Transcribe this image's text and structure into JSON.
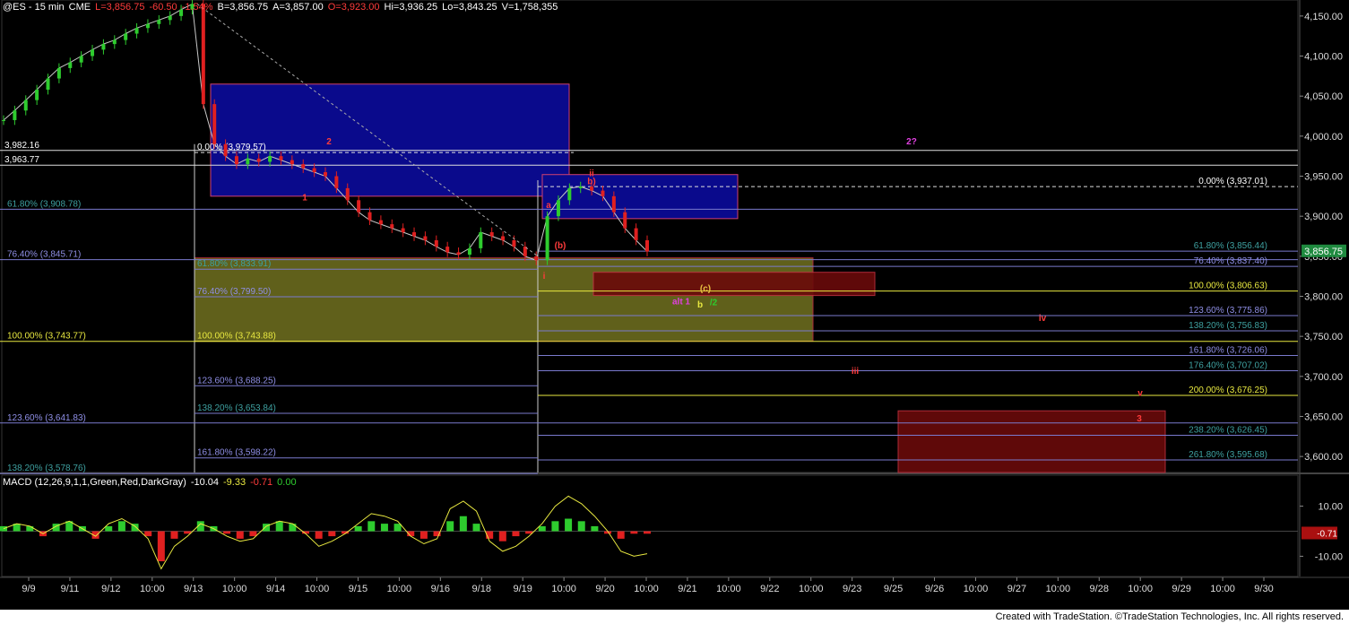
{
  "header": {
    "symbol": "@ES - 15 min",
    "exchange": "CME",
    "last": "L=3,856.75",
    "change": "-60.50",
    "pct": "-1.54%",
    "bid": "B=3,856.75",
    "ask": "A=3,857.00",
    "open": "O=3,923.00",
    "hi": "Hi=3,936.25",
    "lo": "Lo=3,843.25",
    "vol": "V=1,758,355"
  },
  "macd_header": {
    "label": "MACD (12,26,9,1,1,Green,Red,DarkGray)",
    "v1": "-10.04",
    "v2": "-9.33",
    "v3": "-0.71",
    "v4": "0.00"
  },
  "footer": "Created with TradeStation. ©TradeStation Technologies, Inc. All rights reserved.",
  "colors": {
    "background": "#000000",
    "up_candle": "#2ecc2e",
    "down_candle": "#e02020",
    "blue_box": "#0a0a8c",
    "yellow_box": "#6b6b1e",
    "red_box": "#6a0a0a",
    "fib_line": "#7a7acd",
    "price_tag": "#1f8a3f"
  },
  "chart_data": [
    {
      "type": "line",
      "title": "@ES - 15 min",
      "y_ticks": [
        "4,150.00",
        "4,100.00",
        "4,050.00",
        "4,000.00",
        "3,950.00",
        "3,900.00",
        "3,850.00",
        "3,800.00",
        "3,750.00",
        "3,700.00",
        "3,650.00",
        "3,600.00"
      ],
      "y_tick_values": [
        4150,
        4100,
        4050,
        4000,
        3950,
        3900,
        3850,
        3800,
        3750,
        3700,
        3650,
        3600
      ],
      "ylim": [
        3580,
        4170
      ],
      "x_labels": [
        "9/9",
        "9/11",
        "9/12",
        "10:00",
        "9/13",
        "10:00",
        "9/14",
        "10:00",
        "9/15",
        "10:00",
        "9/16",
        "9/18",
        "9/19",
        "10:00",
        "9/20",
        "10:00",
        "9/21",
        "10:00",
        "9/22",
        "10:00",
        "9/23",
        "9/25",
        "9/26",
        "10:00",
        "9/27",
        "10:00",
        "9/28",
        "10:00",
        "9/29",
        "10:00",
        "9/30"
      ],
      "series": [
        {
          "values": [
            4020,
            4032,
            4045,
            4058,
            4072,
            4085,
            4092,
            4100,
            4108,
            4115,
            4120,
            4128,
            4135,
            4140,
            4145,
            4150,
            4158,
            4165,
            4040,
            3990,
            3975,
            3965,
            3972,
            3968,
            3975,
            3970,
            3965,
            3960,
            3955,
            3950,
            3935,
            3920,
            3905,
            3895,
            3890,
            3885,
            3880,
            3875,
            3870,
            3862,
            3855,
            3852,
            3860,
            3880,
            3875,
            3870,
            3862,
            3850,
            3845,
            3900,
            3920,
            3935,
            3937,
            3932,
            3925,
            3905,
            3885,
            3870,
            3856
          ]
        }
      ],
      "last_price": "3,856.75",
      "levels": [
        {
          "label": "3,982.16",
          "value": 3982.16
        },
        {
          "label": "3,963.77",
          "value": 3963.77
        },
        {
          "label": "0.00% (3,979.57)",
          "value": 3979.57
        },
        {
          "label": "61.80% (3,908.78)",
          "value": 3908.78
        },
        {
          "label": "76.40% (3,845.71)",
          "value": 3845.71
        },
        {
          "label": "61.80% (3,833.91)",
          "value": 3833.91
        },
        {
          "label": "76.40% (3,799.50)",
          "value": 3799.5
        },
        {
          "label": "100.00% (3,743.77)",
          "value": 3743.77
        },
        {
          "label": "100.00% (3,743.88)",
          "value": 3743.88
        },
        {
          "label": "123.60% (3,688.25)",
          "value": 3688.25
        },
        {
          "label": "138.20% (3,653.84)",
          "value": 3653.84
        },
        {
          "label": "123.60% (3,641.83)",
          "value": 3641.83
        },
        {
          "label": "161.80% (3,598.22)",
          "value": 3598.22
        },
        {
          "label": "138.20% (3,578.76)",
          "value": 3578.76
        },
        {
          "label": "0.00% (3,937.01)",
          "value": 3937.01
        },
        {
          "label": "61.80% (3,856.44)",
          "value": 3856.44
        },
        {
          "label": "76.40% (3,837.40)",
          "value": 3837.4
        },
        {
          "label": "100.00% (3,806.63)",
          "value": 3806.63
        },
        {
          "label": "123.60% (3,775.86)",
          "value": 3775.86
        },
        {
          "label": "138.20% (3,756.83)",
          "value": 3756.83
        },
        {
          "label": "161.80% (3,726.06)",
          "value": 3726.06
        },
        {
          "label": "176.40% (3,707.02)",
          "value": 3707.02
        },
        {
          "label": "200.00% (3,676.25)",
          "value": 3676.25
        },
        {
          "label": "238.20% (3,626.45)",
          "value": 3626.45
        },
        {
          "label": "261.80% (3,595.68)",
          "value": 3595.68
        }
      ],
      "wave_labels": [
        "2",
        "1",
        "2?",
        "ii",
        "a",
        "(b)",
        "b)",
        "i",
        "(c)",
        "alt 1",
        "b",
        "/2",
        "iv",
        "iii",
        "v",
        "3"
      ]
    },
    {
      "type": "bar",
      "title": "MACD (12,26,9,1,1,Green,Red,DarkGray)",
      "y_ticks": [
        "10.00",
        "-10.00"
      ],
      "y_tick_values": [
        10,
        -10
      ],
      "ylim": [
        -17,
        17
      ],
      "last_value": "-0.71",
      "series": [
        {
          "name": "MACD",
          "values": [
            1,
            3,
            2,
            -1,
            2,
            4,
            1,
            -2,
            3,
            5,
            2,
            -3,
            -15,
            -6,
            -2,
            3,
            1,
            -2,
            -4,
            -3,
            2,
            4,
            3,
            -1,
            -6,
            -4,
            -1,
            3,
            7,
            6,
            4,
            -2,
            -5,
            -3,
            9,
            12,
            8,
            -4,
            -8,
            -6,
            -2,
            3,
            10,
            14,
            11,
            6,
            0,
            -8,
            -10,
            -9
          ]
        },
        {
          "name": "Histogram",
          "values": [
            2,
            3,
            2,
            -2,
            3,
            4,
            2,
            -3,
            2,
            4,
            3,
            -2,
            -12,
            -3,
            -1,
            4,
            2,
            -1,
            -3,
            -2,
            3,
            4,
            3,
            -1,
            -3,
            -2,
            -1,
            2,
            4,
            3,
            3,
            -2,
            -3,
            -2,
            4,
            6,
            3,
            -3,
            -4,
            -2,
            -1,
            2,
            4,
            5,
            4,
            2,
            -1,
            -3,
            -1,
            -1
          ]
        }
      ]
    }
  ]
}
